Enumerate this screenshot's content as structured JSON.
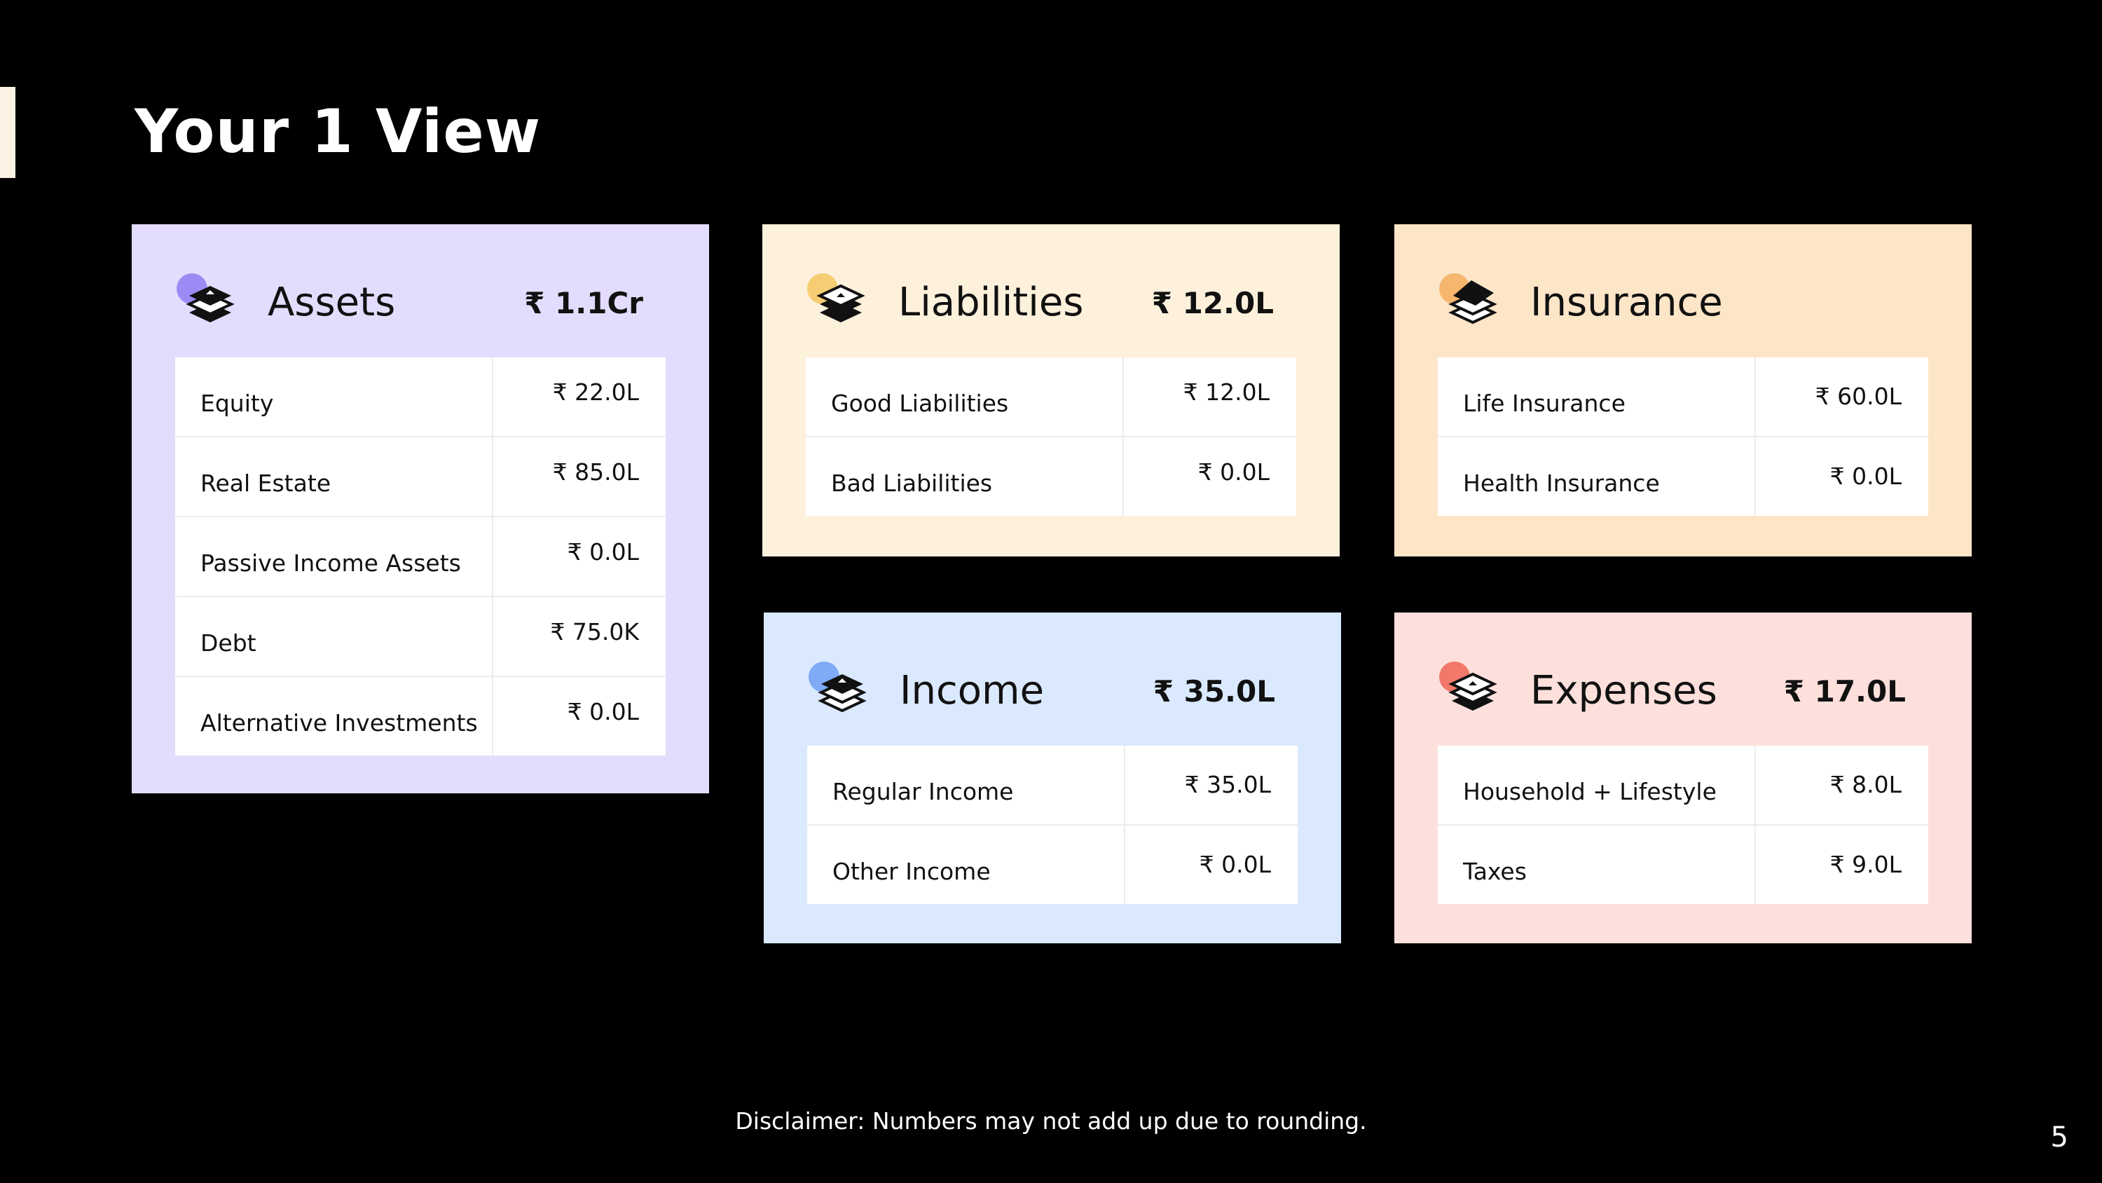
{
  "title": "Your 1 View",
  "disclaimer": "Disclaimer: Numbers may not add up due to rounding.",
  "page_number": "5",
  "colors": {
    "background": "#000000",
    "assets": "#e4dcfd",
    "liabilities": "#fdf1dc",
    "insurance": "#fde5c8",
    "income": "#dae9fd",
    "expenses": "#fde0dc"
  },
  "assets": {
    "title": "Assets",
    "total": "₹ 1.1Cr",
    "icon": "layers-stack-icon",
    "rows": [
      {
        "label": "Equity",
        "value": "₹ 22.0L"
      },
      {
        "label": "Real Estate",
        "value": "₹ 85.0L"
      },
      {
        "label": "Passive Income Assets",
        "value": "₹ 0.0L"
      },
      {
        "label": "Debt",
        "value": "₹ 75.0K"
      },
      {
        "label": "Alternative Investments",
        "value": "₹ 0.0L"
      }
    ]
  },
  "liabilities": {
    "title": "Liabilities",
    "total": "₹ 12.0L",
    "icon": "layers-stack-icon",
    "rows": [
      {
        "label": "Good Liabilities",
        "value": "₹ 12.0L"
      },
      {
        "label": "Bad Liabilities",
        "value": "₹ 0.0L"
      }
    ]
  },
  "insurance": {
    "title": "Insurance",
    "total": "",
    "icon": "layers-house-icon",
    "rows": [
      {
        "label": "Life Insurance",
        "value": "₹ 60.0L"
      },
      {
        "label": "Health Insurance",
        "value": "₹ 0.0L"
      }
    ]
  },
  "income": {
    "title": "Income",
    "total": "₹ 35.0L",
    "icon": "layers-stack-icon",
    "rows": [
      {
        "label": "Regular Income",
        "value": "₹ 35.0L"
      },
      {
        "label": "Other Income",
        "value": "₹ 0.0L"
      }
    ]
  },
  "expenses": {
    "title": "Expenses",
    "total": "₹ 17.0L",
    "icon": "layers-stack-icon",
    "rows": [
      {
        "label": "Household + Lifestyle",
        "value": "₹ 8.0L"
      },
      {
        "label": "Taxes",
        "value": "₹ 9.0L"
      }
    ]
  }
}
